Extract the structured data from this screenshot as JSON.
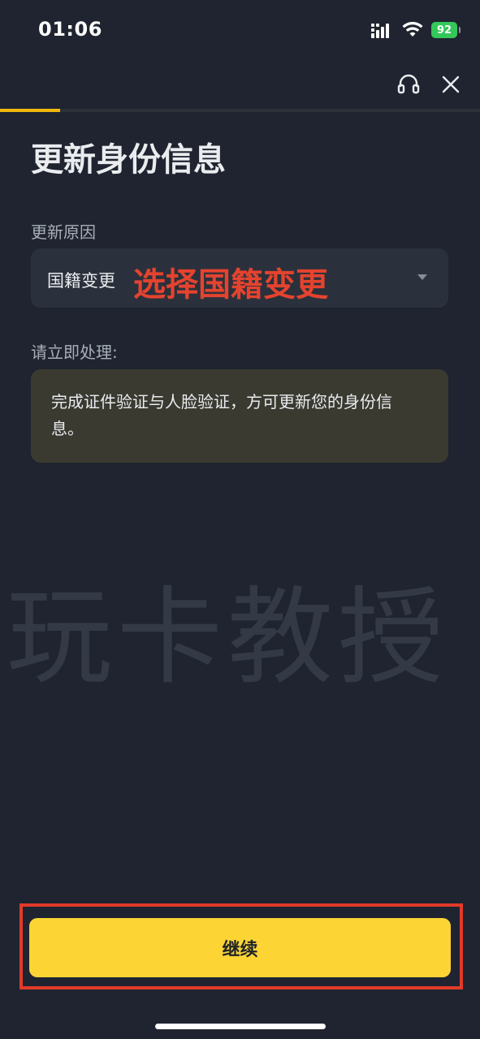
{
  "status_bar": {
    "time": "01:06",
    "battery": "92"
  },
  "icons": {
    "signal": "signal-icon",
    "wifi": "wifi-icon",
    "battery": "battery-icon",
    "support": "headset-icon",
    "close": "close-icon",
    "dropdown": "dropdown-caret-icon"
  },
  "progress": {
    "fraction": 0.125
  },
  "page": {
    "title": "更新身份信息"
  },
  "reason": {
    "label": "更新原因",
    "selected_value": "国籍变更",
    "annotation": "选择国籍变更"
  },
  "action": {
    "label": "请立即处理:",
    "notice": "完成证件验证与人脸验证，方可更新您的身份信息。"
  },
  "watermark": {
    "text": "玩卡教授"
  },
  "footer": {
    "continue_label": "继续"
  },
  "colors": {
    "background": "#1f2430",
    "accent": "#fcd535",
    "progress": "#f0b90b",
    "annotation_red": "#e5432e",
    "notice_bg": "#3a3a31"
  }
}
